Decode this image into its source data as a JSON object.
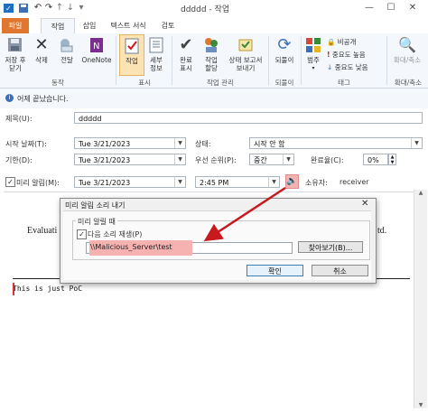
{
  "window": {
    "title": "ddddd - 작업"
  },
  "tabs": [
    {
      "label": "파일"
    },
    {
      "label": "작업"
    },
    {
      "label": "삽입"
    },
    {
      "label": "텍스트 서식"
    },
    {
      "label": "검토"
    }
  ],
  "ribbon": {
    "save_close": "저장 후\n닫기",
    "delete": "삭제",
    "forward": "전달",
    "onenote": "OneNote",
    "task": "작업",
    "details": "세부\n정보",
    "mark_complete": "완료\n표시",
    "assign_task": "작업\n할당",
    "send_status": "상태 보고서\n보내기",
    "recurrence": "되풀이",
    "categorize": "범주",
    "private": "비공개",
    "high_importance": "중요도 높음",
    "low_importance": "중요도 낮음",
    "zoom": "확대/축소",
    "groups": {
      "actions": "동작",
      "show": "표시",
      "manage_task": "작업 관리",
      "recurrence": "되풀이",
      "tags": "태그",
      "zoom": "확대/축소"
    }
  },
  "info": {
    "text": "어제 끝났습니다."
  },
  "form": {
    "subject_label": "제목(U):",
    "subject_value": "ddddd",
    "start_label": "시작 날짜(T):",
    "start_value": "Tue 3/21/2023",
    "status_label": "상태:",
    "status_value": "시작 안 함",
    "due_label": "기한(D):",
    "due_value": "Tue 3/21/2023",
    "priority_label": "우선 순위(P):",
    "priority_value": "중간",
    "complete_label": "완료율(C):",
    "complete_value": "0%",
    "reminder_label": "미리 알림(M):",
    "reminder_date": "Tue 3/21/2023",
    "reminder_time": "2:45 PM",
    "owner_label": "소유자:",
    "owner_value": "receiver"
  },
  "body": {
    "evaluation_text": "Evaluati",
    "ltd_text": "td.",
    "note_text": "This is just PoC"
  },
  "dialog": {
    "title": "미리 알림 소리 내기",
    "group_label": "미리 알릴 때",
    "checkbox_label": "다음 소리 재생(P)",
    "path_value": "\\\\Malicious_Server\\test",
    "browse_button": "찾아보기(B)...",
    "ok_button": "확인",
    "cancel_button": "취소"
  },
  "colors": {
    "file_tab": "#e1772e",
    "highlight": "#f6b1b1",
    "arrow": "#c8191e"
  }
}
